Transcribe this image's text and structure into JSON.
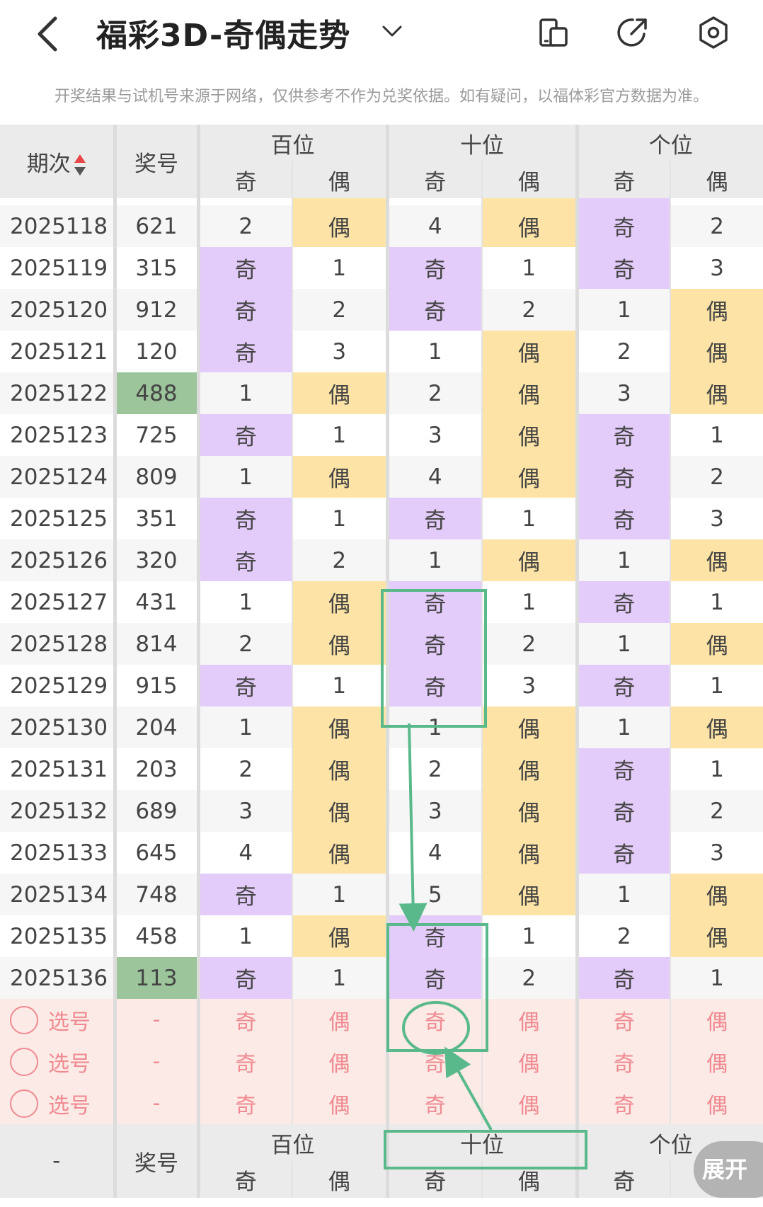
{
  "header": {
    "title": "福彩3D-奇偶走势",
    "icons": [
      "back-icon",
      "chevron-down-icon",
      "device-switch-icon",
      "share-icon",
      "settings-icon"
    ]
  },
  "notice": "开奖结果与试机号来源于网络，仅供参考不作为兑奖依据。如有疑问，以福体彩官方数据为准。",
  "table": {
    "col_issue": "期次",
    "col_number": "奖号",
    "groups": [
      "百位",
      "十位",
      "个位"
    ],
    "sub": [
      "奇",
      "偶"
    ],
    "rows": [
      {
        "issue": "2025118",
        "num": "621",
        "c": [
          "2",
          "偶",
          "4",
          "偶",
          "奇",
          "2"
        ],
        "hl": [
          "",
          "e",
          "",
          "e",
          "o",
          ""
        ]
      },
      {
        "issue": "2025119",
        "num": "315",
        "c": [
          "奇",
          "1",
          "奇",
          "1",
          "奇",
          "3"
        ],
        "hl": [
          "o",
          "",
          "o",
          "",
          "o",
          ""
        ]
      },
      {
        "issue": "2025120",
        "num": "912",
        "c": [
          "奇",
          "2",
          "奇",
          "2",
          "1",
          "偶"
        ],
        "hl": [
          "o",
          "",
          "o",
          "",
          "",
          "e"
        ]
      },
      {
        "issue": "2025121",
        "num": "120",
        "c": [
          "奇",
          "3",
          "1",
          "偶",
          "2",
          "偶"
        ],
        "hl": [
          "o",
          "",
          "",
          "e",
          "",
          "e"
        ]
      },
      {
        "issue": "2025122",
        "num": "488",
        "green": true,
        "c": [
          "1",
          "偶",
          "2",
          "偶",
          "3",
          "偶"
        ],
        "hl": [
          "",
          "e",
          "",
          "e",
          "",
          "e"
        ]
      },
      {
        "issue": "2025123",
        "num": "725",
        "c": [
          "奇",
          "1",
          "3",
          "偶",
          "奇",
          "1"
        ],
        "hl": [
          "o",
          "",
          "",
          "e",
          "o",
          ""
        ]
      },
      {
        "issue": "2025124",
        "num": "809",
        "c": [
          "1",
          "偶",
          "4",
          "偶",
          "奇",
          "2"
        ],
        "hl": [
          "",
          "e",
          "",
          "e",
          "o",
          ""
        ]
      },
      {
        "issue": "2025125",
        "num": "351",
        "c": [
          "奇",
          "1",
          "奇",
          "1",
          "奇",
          "3"
        ],
        "hl": [
          "o",
          "",
          "o",
          "",
          "o",
          ""
        ]
      },
      {
        "issue": "2025126",
        "num": "320",
        "c": [
          "奇",
          "2",
          "1",
          "偶",
          "1",
          "偶"
        ],
        "hl": [
          "o",
          "",
          "",
          "e",
          "",
          "e"
        ]
      },
      {
        "issue": "2025127",
        "num": "431",
        "c": [
          "1",
          "偶",
          "奇",
          "1",
          "奇",
          "1"
        ],
        "hl": [
          "",
          "e",
          "o",
          "",
          "o",
          ""
        ]
      },
      {
        "issue": "2025128",
        "num": "814",
        "c": [
          "2",
          "偶",
          "奇",
          "2",
          "1",
          "偶"
        ],
        "hl": [
          "",
          "e",
          "o",
          "",
          "",
          "e"
        ]
      },
      {
        "issue": "2025129",
        "num": "915",
        "c": [
          "奇",
          "1",
          "奇",
          "3",
          "奇",
          "1"
        ],
        "hl": [
          "o",
          "",
          "o",
          "",
          "o",
          ""
        ]
      },
      {
        "issue": "2025130",
        "num": "204",
        "c": [
          "1",
          "偶",
          "1",
          "偶",
          "1",
          "偶"
        ],
        "hl": [
          "",
          "e",
          "",
          "e",
          "",
          "e"
        ]
      },
      {
        "issue": "2025131",
        "num": "203",
        "c": [
          "2",
          "偶",
          "2",
          "偶",
          "奇",
          "1"
        ],
        "hl": [
          "",
          "e",
          "",
          "e",
          "o",
          ""
        ]
      },
      {
        "issue": "2025132",
        "num": "689",
        "c": [
          "3",
          "偶",
          "3",
          "偶",
          "奇",
          "2"
        ],
        "hl": [
          "",
          "e",
          "",
          "e",
          "o",
          ""
        ]
      },
      {
        "issue": "2025133",
        "num": "645",
        "c": [
          "4",
          "偶",
          "4",
          "偶",
          "奇",
          "3"
        ],
        "hl": [
          "",
          "e",
          "",
          "e",
          "o",
          ""
        ]
      },
      {
        "issue": "2025134",
        "num": "748",
        "c": [
          "奇",
          "1",
          "5",
          "偶",
          "1",
          "偶"
        ],
        "hl": [
          "o",
          "",
          "",
          "e",
          "",
          "e"
        ]
      },
      {
        "issue": "2025135",
        "num": "458",
        "c": [
          "1",
          "偶",
          "奇",
          "1",
          "2",
          "偶"
        ],
        "hl": [
          "",
          "e",
          "o",
          "",
          "",
          "e"
        ]
      },
      {
        "issue": "2025136",
        "num": "113",
        "green": true,
        "c": [
          "奇",
          "1",
          "奇",
          "2",
          "奇",
          "1"
        ],
        "hl": [
          "o",
          "",
          "o",
          "",
          "o",
          ""
        ]
      }
    ],
    "pick_rows": [
      {
        "label": "选号",
        "num": "-",
        "c": [
          "奇",
          "偶",
          "奇",
          "偶",
          "奇",
          "偶"
        ]
      },
      {
        "label": "选号",
        "num": "-",
        "c": [
          "奇",
          "偶",
          "奇",
          "偶",
          "奇",
          "偶"
        ]
      },
      {
        "label": "选号",
        "num": "-",
        "c": [
          "奇",
          "偶",
          "奇",
          "偶",
          "奇",
          "偶"
        ]
      }
    ],
    "footer": {
      "issue": "-",
      "number": "奖号",
      "groups": [
        "百位",
        "十位",
        "个位"
      ],
      "sub": [
        "奇",
        "偶",
        "奇",
        "偶",
        "奇"
      ]
    }
  },
  "expand_button": "展开",
  "colors": {
    "odd": "#e4ccfa",
    "odd_text": "#9a55d8",
    "even": "#fde4a6",
    "even_text": "#f29a23",
    "highlight_number": "#9cc59b",
    "annotation": "#5ab98a",
    "pick_row": "#fbeae6"
  }
}
